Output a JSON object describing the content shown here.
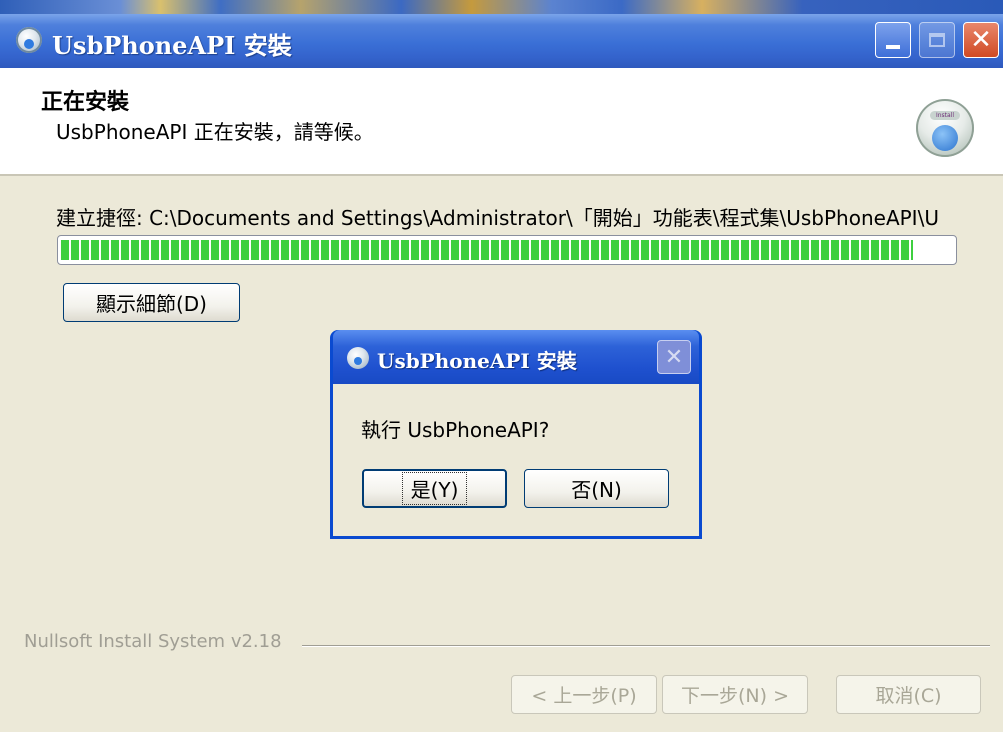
{
  "window": {
    "title": "UsbPhoneAPI 安裝",
    "controls": {
      "minimize": "minimize-icon",
      "maximize": "maximize-icon",
      "close": "✕"
    }
  },
  "header": {
    "title": "正在安裝",
    "subtitle": "UsbPhoneAPI 正在安裝，請等候。",
    "label": "Install"
  },
  "main": {
    "status_text": "建立捷徑: C:\\Documents and Settings\\Administrator\\「開始」功能表\\程式集\\UsbPhoneAPI\\U",
    "progress_fraction": 0.955,
    "details_button": "顯示細節(D)"
  },
  "footer": {
    "brand": "Nullsoft Install System v2.18",
    "back_button": "< 上一步(P)",
    "next_button": "下一步(N) >",
    "cancel_button": "取消(C)"
  },
  "dialog": {
    "title": "UsbPhoneAPI 安裝",
    "message": "執行 UsbPhoneAPI?",
    "yes_button": "是(Y)",
    "no_button": "否(N)",
    "close": "✕"
  },
  "colors": {
    "titlebar": "#3463cc",
    "progress": "#3dcf3f",
    "face": "#ece9d8"
  }
}
